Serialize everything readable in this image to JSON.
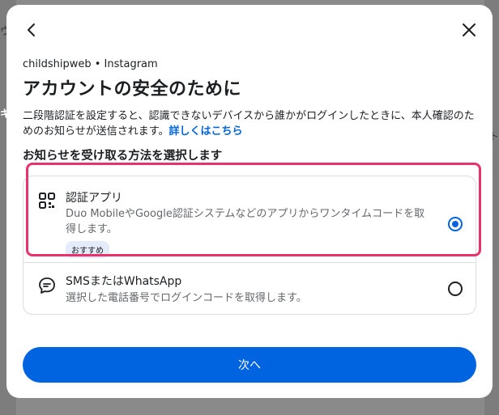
{
  "background": {
    "left_text_1": "ウ",
    "left_text_2": "キ",
    "right_text": "ト"
  },
  "modal": {
    "back_icon": "chevron-left-icon",
    "close_icon": "close-icon",
    "account_line": "childshipweb • Instagram",
    "title": "アカウントの安全のために",
    "description": "二段階認証を設定すると、認識できないデバイスから誰かがログインしたときに、本人確認のためのお知らせが送信されます。",
    "learn_more": "詳しくはこちら",
    "section_heading": "お知らせを受け取る方法を選択します",
    "options": [
      {
        "title": "認証アプリ",
        "description": "Duo MobileやGoogle認証システムなどのアプリからワンタイムコードを取得します。",
        "badge": "おすすめ",
        "selected": true,
        "icon": "qr-code-icon"
      },
      {
        "title": "SMSまたはWhatsApp",
        "description": "選択した電話番号でログインコードを取得します。",
        "selected": false,
        "icon": "chat-bubble-icon"
      }
    ],
    "next_button": "次へ"
  },
  "colors": {
    "accent": "#0064e0",
    "highlight": "#e8336d"
  }
}
